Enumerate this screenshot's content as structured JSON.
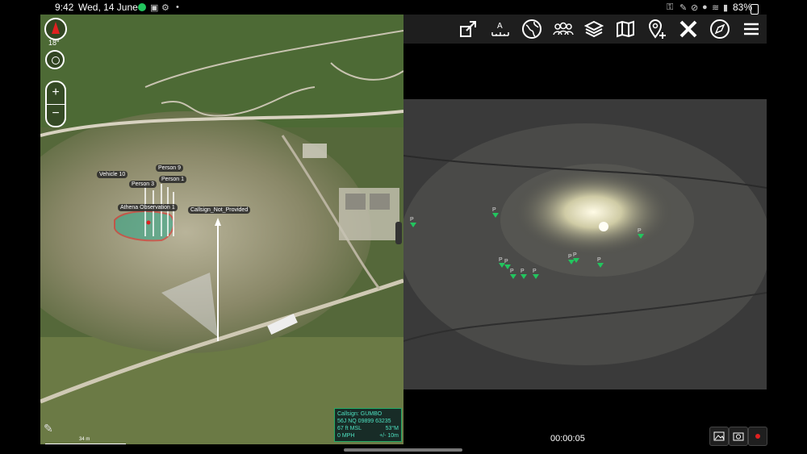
{
  "status_bar": {
    "time": "9:42",
    "date": "Wed, 14 June",
    "battery": "83%",
    "record_color": "#22c55e"
  },
  "map": {
    "compass_bearing": "18°",
    "zoom_in": "+",
    "zoom_out": "−",
    "scale_label": "34 m",
    "labels": {
      "vehicle10": "Vehicle 10",
      "person3": "Person 3",
      "person9": "Person 9",
      "person1": "Person 1",
      "athena": "Athena Observation 1",
      "callsign_np": "Callsign_Not_Provided"
    },
    "info": {
      "callsign": "Callsign: GUMBO",
      "grid": "56J  NQ  09899  63235",
      "altitude": "67 ft MSL",
      "heading": "53°M",
      "speed": "0 MPH",
      "accuracy": "+/- 10m"
    }
  },
  "toolbar": {
    "icons": [
      "expand-icon",
      "ruler-icon",
      "globe-icon",
      "contacts-icon",
      "layers-icon",
      "map-icon",
      "add-marker-icon",
      "tools-icon",
      "compass-alt-icon",
      "menu-icon"
    ]
  },
  "video": {
    "timer": "00:00:05",
    "track_marker": "P"
  }
}
